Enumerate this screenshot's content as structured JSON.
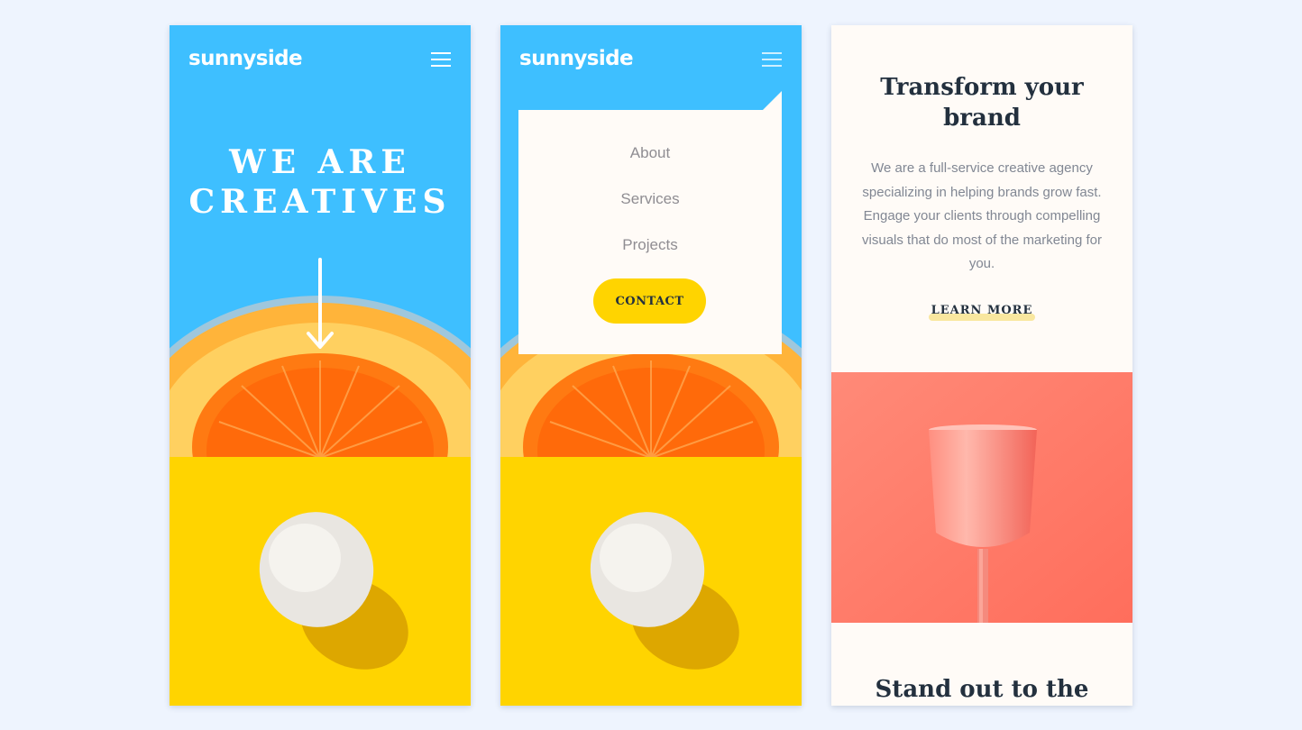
{
  "brand": {
    "logo": "sunnyside",
    "colors": {
      "page_bg": "#eef4fe",
      "sky_blue": "#3ebfff",
      "yellow": "#ffd400",
      "cream": "#fffbf7",
      "dark_text": "#23303e",
      "grey_text": "#818793",
      "coral": "#ff7e6b",
      "orange": "#ff8c1a",
      "learn_more_highlight": "#f9e79f"
    }
  },
  "hero": {
    "title_line1": "WE ARE",
    "title_line2": "CREATIVES",
    "scroll_icon": "arrow-down-icon",
    "menu_icon": "hamburger-menu-icon"
  },
  "menu": {
    "items": [
      "About",
      "Services",
      "Projects"
    ],
    "contact_label": "CONTACT"
  },
  "transform": {
    "title_line1": "Transform your",
    "title_line2": "brand",
    "text": "We are a full-service creative agency specializing in helping brands grow fast. Engage your clients through compelling visuals that do most of the marketing for you.",
    "cta": "LEARN MORE"
  },
  "standout": {
    "title": "Stand out to the"
  }
}
